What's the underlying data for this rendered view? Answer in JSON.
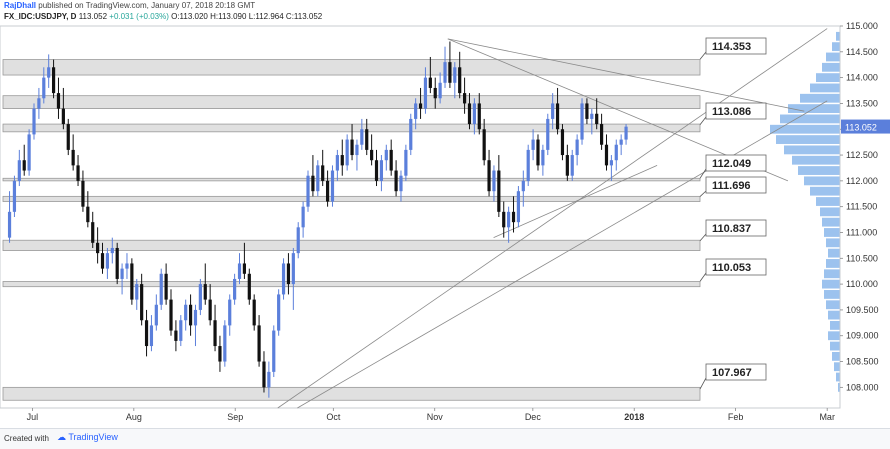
{
  "header": {
    "author": "RajDhall",
    "published": "published on TradingView.com, January 07, 2018 20:18 GMT",
    "symbol": "FX_IDC:USDJPY, D",
    "last": "113.052",
    "change": "+0.031 (+0.03%)",
    "open": "O:113.020",
    "high": "H:113.090",
    "low": "L:112.964",
    "close": "C:113.052"
  },
  "footer": {
    "created_with": "Created with",
    "brand": "TradingView"
  },
  "colors": {
    "up": "#5b7fdb",
    "down": "#111111",
    "zone": "#dadada",
    "line": "#8a8a8a",
    "profile": "#4a8fe0",
    "price_tag": "#5b7fdb"
  },
  "chart_data": {
    "type": "candlestick",
    "title": "FX_IDC:USDJPY, D",
    "ylim": [
      107.6,
      115.0
    ],
    "y_ticks": [
      "115.000",
      "114.500",
      "114.000",
      "113.500",
      "113.000",
      "112.500",
      "112.000",
      "111.500",
      "111.000",
      "110.500",
      "110.000",
      "109.500",
      "109.000",
      "108.500",
      "108.000"
    ],
    "x_ticks": [
      "Jul",
      "Aug",
      "Sep",
      "Oct",
      "Nov",
      "Dec",
      "2018",
      "Feb",
      "Mar"
    ],
    "x_tick_positions_days": [
      9,
      40,
      71,
      101,
      132,
      162,
      193,
      224,
      252
    ],
    "last_price_label": "113.052",
    "levels": [
      {
        "label": "114.353",
        "low": 114.05,
        "high": 114.35
      },
      {
        "label": "113.086",
        "low": 113.4,
        "high": 113.65
      },
      {
        "label": "113.086",
        "low": 112.95,
        "high": 113.1
      },
      {
        "label": "112.049",
        "low": 112.0,
        "high": 112.05
      },
      {
        "label": "111.696",
        "low": 111.6,
        "high": 111.7
      },
      {
        "label": "110.837",
        "low": 110.65,
        "high": 110.85
      },
      {
        "label": "110.053",
        "low": 109.95,
        "high": 110.05
      },
      {
        "label": "107.967",
        "low": 107.75,
        "high": 108.0
      }
    ],
    "level_labels": [
      "114.353",
      "113.086",
      "112.049",
      "111.696",
      "110.837",
      "110.053",
      "107.967"
    ],
    "trendlines": [
      {
        "from": [
          136,
          114.75
        ],
        "to": [
          245,
          113.35
        ]
      },
      {
        "from": [
          136,
          114.75
        ],
        "to": [
          240,
          112.0
        ]
      },
      {
        "from": [
          84,
          107.6
        ],
        "to": [
          252,
          114.95
        ]
      },
      {
        "from": [
          90,
          107.6
        ],
        "to": [
          252,
          113.55
        ]
      },
      {
        "from": [
          150,
          110.9
        ],
        "to": [
          200,
          112.3
        ]
      }
    ],
    "candles": [
      [
        110.9,
        111.8,
        110.8,
        111.4
      ],
      [
        111.4,
        112.1,
        111.3,
        112.0
      ],
      [
        112.0,
        112.6,
        111.9,
        112.4
      ],
      [
        112.4,
        112.7,
        112.1,
        112.2
      ],
      [
        112.2,
        113.0,
        112.1,
        112.9
      ],
      [
        112.9,
        113.5,
        112.8,
        113.4
      ],
      [
        113.4,
        113.8,
        113.2,
        113.6
      ],
      [
        113.6,
        114.2,
        113.5,
        114.0
      ],
      [
        114.0,
        114.45,
        113.8,
        114.2
      ],
      [
        114.2,
        114.35,
        113.6,
        113.7
      ],
      [
        113.7,
        114.0,
        113.2,
        113.4
      ],
      [
        113.4,
        113.8,
        113.0,
        113.1
      ],
      [
        113.1,
        113.2,
        112.5,
        112.6
      ],
      [
        112.6,
        112.9,
        112.2,
        112.3
      ],
      [
        112.3,
        112.5,
        111.9,
        112.0
      ],
      [
        112.0,
        112.2,
        111.4,
        111.5
      ],
      [
        111.5,
        111.8,
        111.1,
        111.2
      ],
      [
        111.2,
        111.4,
        110.7,
        110.8
      ],
      [
        110.8,
        111.1,
        110.4,
        110.6
      ],
      [
        110.6,
        110.8,
        110.2,
        110.3
      ],
      [
        110.3,
        110.7,
        110.1,
        110.6
      ],
      [
        110.6,
        110.9,
        110.4,
        110.7
      ],
      [
        110.7,
        110.8,
        110.0,
        110.1
      ],
      [
        110.1,
        110.4,
        109.8,
        110.3
      ],
      [
        110.3,
        110.6,
        110.1,
        110.4
      ],
      [
        110.4,
        110.5,
        109.6,
        109.7
      ],
      [
        109.7,
        110.1,
        109.5,
        110.0
      ],
      [
        110.0,
        110.2,
        109.2,
        109.3
      ],
      [
        109.3,
        109.5,
        108.6,
        108.8
      ],
      [
        108.8,
        109.4,
        108.7,
        109.2
      ],
      [
        109.2,
        109.8,
        109.1,
        109.6
      ],
      [
        109.6,
        110.3,
        109.5,
        110.2
      ],
      [
        110.2,
        110.4,
        109.6,
        109.7
      ],
      [
        109.7,
        109.9,
        109.0,
        109.1
      ],
      [
        109.1,
        109.3,
        108.7,
        108.9
      ],
      [
        108.9,
        109.4,
        108.8,
        109.3
      ],
      [
        109.3,
        109.7,
        109.1,
        109.6
      ],
      [
        109.6,
        109.8,
        109.0,
        109.2
      ],
      [
        109.2,
        109.6,
        108.8,
        109.5
      ],
      [
        109.5,
        110.1,
        109.4,
        110.0
      ],
      [
        110.0,
        110.4,
        109.6,
        109.7
      ],
      [
        109.7,
        110.0,
        109.2,
        109.3
      ],
      [
        109.3,
        109.6,
        108.7,
        108.8
      ],
      [
        108.8,
        109.0,
        108.3,
        108.5
      ],
      [
        108.5,
        109.3,
        108.4,
        109.2
      ],
      [
        109.2,
        109.8,
        109.0,
        109.7
      ],
      [
        109.7,
        110.2,
        109.6,
        110.1
      ],
      [
        110.1,
        110.6,
        110.0,
        110.4
      ],
      [
        110.4,
        110.8,
        110.1,
        110.2
      ],
      [
        110.2,
        110.3,
        109.6,
        109.7
      ],
      [
        109.7,
        109.8,
        109.1,
        109.2
      ],
      [
        109.2,
        109.4,
        108.4,
        108.5
      ],
      [
        108.5,
        108.7,
        107.9,
        108.0
      ],
      [
        108.0,
        108.5,
        107.8,
        108.3
      ],
      [
        108.3,
        109.2,
        108.2,
        109.1
      ],
      [
        109.1,
        109.9,
        109.0,
        109.8
      ],
      [
        109.8,
        110.5,
        109.7,
        110.4
      ],
      [
        110.4,
        110.6,
        109.8,
        110.0
      ],
      [
        110.0,
        110.7,
        109.5,
        110.6
      ],
      [
        110.6,
        111.2,
        110.5,
        111.1
      ],
      [
        111.1,
        111.6,
        110.9,
        111.5
      ],
      [
        111.5,
        112.2,
        111.4,
        112.1
      ],
      [
        112.1,
        112.5,
        111.7,
        111.8
      ],
      [
        111.8,
        112.4,
        111.7,
        112.3
      ],
      [
        112.3,
        112.6,
        111.9,
        112.0
      ],
      [
        112.0,
        112.2,
        111.5,
        111.6
      ],
      [
        111.6,
        112.3,
        111.5,
        112.2
      ],
      [
        112.2,
        112.6,
        112.0,
        112.5
      ],
      [
        112.5,
        112.8,
        112.1,
        112.3
      ],
      [
        112.3,
        112.9,
        112.2,
        112.8
      ],
      [
        112.8,
        113.1,
        112.4,
        112.5
      ],
      [
        112.5,
        112.8,
        112.2,
        112.7
      ],
      [
        112.7,
        113.2,
        112.6,
        113.0
      ],
      [
        113.0,
        113.2,
        112.5,
        112.6
      ],
      [
        112.6,
        112.9,
        112.3,
        112.4
      ],
      [
        112.4,
        112.6,
        111.9,
        112.0
      ],
      [
        112.0,
        112.5,
        111.8,
        112.4
      ],
      [
        112.4,
        112.7,
        112.2,
        112.6
      ],
      [
        112.6,
        112.8,
        112.1,
        112.2
      ],
      [
        112.2,
        112.4,
        111.7,
        111.8
      ],
      [
        111.8,
        112.2,
        111.6,
        112.1
      ],
      [
        112.1,
        112.7,
        112.0,
        112.6
      ],
      [
        112.6,
        113.3,
        112.5,
        113.2
      ],
      [
        113.2,
        113.6,
        113.0,
        113.5
      ],
      [
        113.5,
        113.8,
        113.2,
        113.4
      ],
      [
        113.4,
        114.2,
        113.3,
        114.0
      ],
      [
        114.0,
        114.4,
        113.7,
        113.8
      ],
      [
        113.8,
        114.0,
        113.4,
        113.6
      ],
      [
        113.6,
        114.1,
        113.5,
        113.9
      ],
      [
        113.9,
        114.6,
        113.8,
        114.3
      ],
      [
        114.3,
        114.7,
        113.8,
        113.9
      ],
      [
        113.9,
        114.3,
        113.6,
        114.2
      ],
      [
        114.2,
        114.5,
        113.6,
        113.7
      ],
      [
        113.7,
        114.0,
        113.3,
        113.5
      ],
      [
        113.5,
        113.7,
        113.0,
        113.1
      ],
      [
        113.1,
        113.6,
        112.9,
        113.5
      ],
      [
        113.5,
        113.7,
        112.9,
        113.0
      ],
      [
        113.0,
        113.2,
        112.3,
        112.4
      ],
      [
        112.4,
        112.6,
        111.7,
        111.8
      ],
      [
        111.8,
        112.3,
        111.6,
        112.2
      ],
      [
        112.2,
        112.5,
        111.3,
        111.4
      ],
      [
        111.4,
        111.6,
        110.9,
        111.1
      ],
      [
        111.1,
        111.5,
        110.8,
        111.4
      ],
      [
        111.4,
        111.7,
        111.0,
        111.2
      ],
      [
        111.2,
        111.9,
        111.1,
        111.8
      ],
      [
        111.8,
        112.2,
        111.5,
        112.0
      ],
      [
        112.0,
        112.7,
        111.9,
        112.6
      ],
      [
        112.6,
        113.0,
        112.4,
        112.8
      ],
      [
        112.8,
        112.9,
        112.2,
        112.3
      ],
      [
        112.3,
        112.7,
        112.1,
        112.6
      ],
      [
        112.6,
        113.3,
        112.5,
        113.2
      ],
      [
        113.2,
        113.7,
        113.0,
        113.5
      ],
      [
        113.5,
        113.8,
        112.9,
        113.0
      ],
      [
        113.0,
        113.1,
        112.4,
        112.5
      ],
      [
        112.5,
        112.7,
        112.0,
        112.1
      ],
      [
        112.1,
        112.6,
        112.0,
        112.5
      ],
      [
        112.5,
        112.9,
        112.3,
        112.8
      ],
      [
        112.8,
        113.6,
        112.7,
        113.5
      ],
      [
        113.5,
        113.6,
        113.1,
        113.2
      ],
      [
        113.2,
        113.4,
        112.9,
        113.3
      ],
      [
        113.3,
        113.6,
        113.0,
        113.1
      ],
      [
        113.1,
        113.3,
        112.6,
        112.7
      ],
      [
        112.7,
        112.9,
        112.2,
        112.3
      ],
      [
        112.3,
        112.5,
        112.0,
        112.4
      ],
      [
        112.4,
        112.8,
        112.2,
        112.7
      ],
      [
        112.7,
        112.9,
        112.5,
        112.8
      ],
      [
        112.8,
        113.1,
        112.7,
        113.05
      ]
    ],
    "volume_profile": [
      [
        114.8,
        4
      ],
      [
        114.6,
        8
      ],
      [
        114.4,
        14
      ],
      [
        114.2,
        18
      ],
      [
        114.0,
        24
      ],
      [
        113.8,
        30
      ],
      [
        113.6,
        40
      ],
      [
        113.4,
        52
      ],
      [
        113.2,
        60
      ],
      [
        113.0,
        70
      ],
      [
        112.8,
        64
      ],
      [
        112.6,
        56
      ],
      [
        112.4,
        48
      ],
      [
        112.2,
        42
      ],
      [
        112.0,
        36
      ],
      [
        111.8,
        30
      ],
      [
        111.6,
        24
      ],
      [
        111.4,
        20
      ],
      [
        111.2,
        18
      ],
      [
        111.0,
        16
      ],
      [
        110.8,
        14
      ],
      [
        110.6,
        12
      ],
      [
        110.4,
        14
      ],
      [
        110.2,
        16
      ],
      [
        110.0,
        18
      ],
      [
        109.8,
        16
      ],
      [
        109.6,
        14
      ],
      [
        109.4,
        12
      ],
      [
        109.2,
        10
      ],
      [
        109.0,
        12
      ],
      [
        108.8,
        10
      ],
      [
        108.6,
        8
      ],
      [
        108.4,
        6
      ],
      [
        108.2,
        4
      ],
      [
        108.0,
        2
      ]
    ]
  }
}
